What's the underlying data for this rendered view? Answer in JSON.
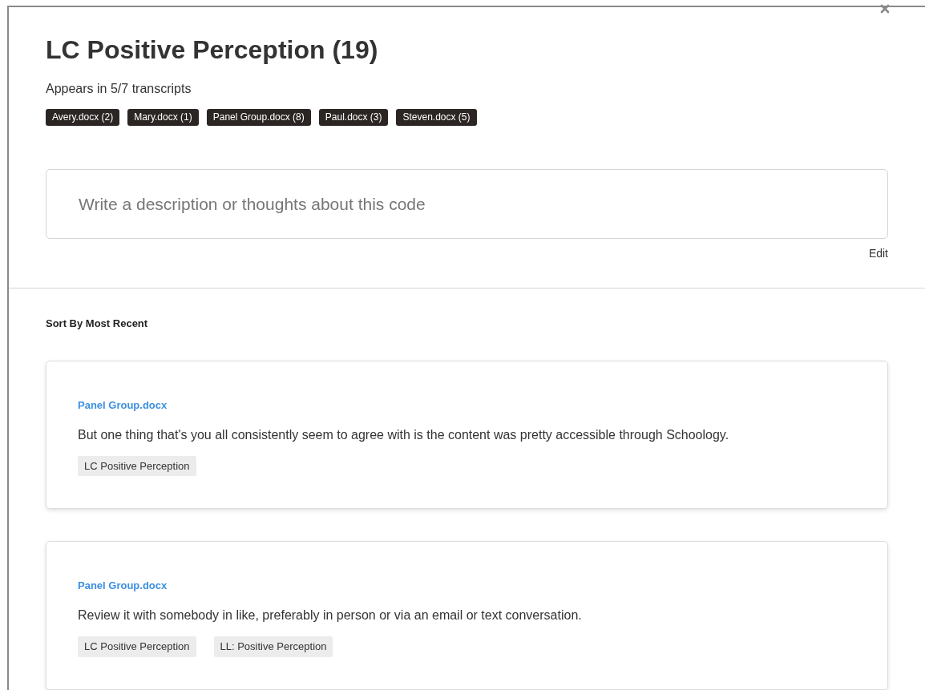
{
  "header": {
    "title": "LC Positive Perception (19)",
    "summary": "Appears in 5/7 transcripts",
    "files": [
      {
        "label": "Avery.docx (2)"
      },
      {
        "label": "Mary.docx (1)"
      },
      {
        "label": "Panel Group.docx (8)"
      },
      {
        "label": "Paul.docx (3)"
      },
      {
        "label": "Steven.docx (5)"
      }
    ]
  },
  "description": {
    "placeholder": "Write a description or thoughts about this code",
    "edit_label": "Edit"
  },
  "sort_label": "Sort By Most Recent",
  "excerpts": [
    {
      "source": "Panel Group.docx",
      "text": "But one thing that's you all consistently seem to agree with is the content was pretty accessible through Schoology.",
      "codes": [
        "LC Positive Perception"
      ]
    },
    {
      "source": "Panel Group.docx",
      "text": "Review it with somebody in like, preferably in person or via an email or text conversation.",
      "codes": [
        "LC Positive Perception",
        "LL: Positive Perception"
      ]
    }
  ]
}
